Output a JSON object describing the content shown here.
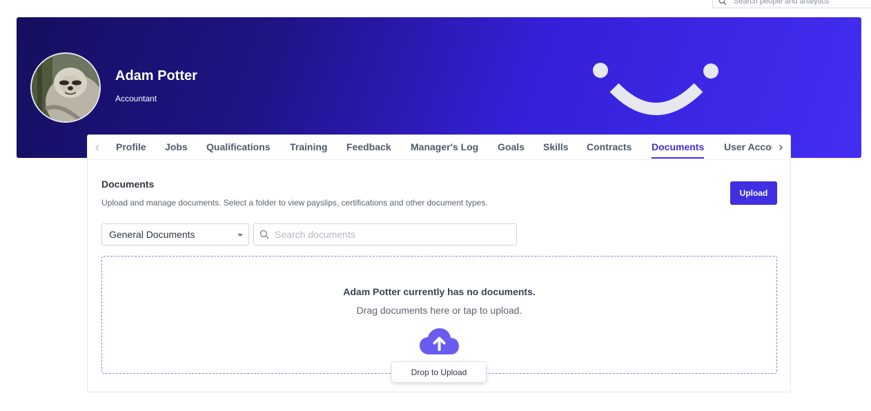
{
  "topbar": {
    "search_placeholder": "Search people and analytics"
  },
  "profile": {
    "name": "Adam Potter",
    "role": "Accountant"
  },
  "tabs": [
    {
      "label": "Profile"
    },
    {
      "label": "Jobs"
    },
    {
      "label": "Qualifications"
    },
    {
      "label": "Training"
    },
    {
      "label": "Feedback"
    },
    {
      "label": "Manager's Log"
    },
    {
      "label": "Goals"
    },
    {
      "label": "Skills"
    },
    {
      "label": "Contracts"
    },
    {
      "label": "Documents",
      "active": true
    },
    {
      "label": "User Account"
    }
  ],
  "documents": {
    "title": "Documents",
    "description": "Upload and manage documents. Select a folder to view payslips, certifications and other document types.",
    "upload_label": "Upload",
    "folder_selected": "General Documents",
    "search_placeholder": "Search documents",
    "empty_title": "Adam Potter currently has no documents.",
    "empty_subtitle": "Drag documents here or tap to upload.",
    "drop_tooltip": "Drop to Upload"
  },
  "colors": {
    "accent": "#3f2fe0",
    "banner_dark": "#150f5f",
    "banner_light": "#432ef2",
    "cloud": "#6b5cf0"
  },
  "icons": {
    "search": "search-icon",
    "chevron_left": "chevron-left-icon",
    "chevron_right": "chevron-right-icon",
    "upload_cloud": "cloud-upload-icon",
    "caret": "caret-down-icon"
  }
}
